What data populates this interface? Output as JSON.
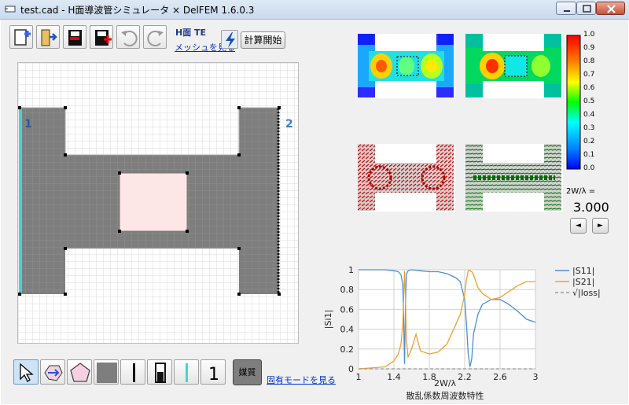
{
  "window": {
    "title": "test.cad - H面導波管シミュレータ  × DelFEM 1.6.0.3"
  },
  "toolbar": {
    "mode_label": "H面 TE",
    "mesh_link": "メッシュを見る",
    "calc_button": "計算開始"
  },
  "ports": {
    "port1": "1",
    "port2": "2"
  },
  "colorbar": {
    "ticks": [
      "1.0",
      "0.9",
      "0.8",
      "0.7",
      "0.6",
      "0.5",
      "0.4",
      "0.3",
      "0.2",
      "0.1",
      "0.0"
    ]
  },
  "frequency": {
    "label": "2W/λ =",
    "value": "3.000",
    "prev": "◄",
    "next": "►"
  },
  "bottom_toolbar": {
    "medium_label": "媒質",
    "eigen_link": "固有モードを見る"
  },
  "chart_data": {
    "type": "line",
    "xlabel": "2W/λ",
    "ylabel": "|Si1|",
    "title": "散乱係数周波数特性",
    "xlim": [
      1,
      3
    ],
    "ylim": [
      0,
      1
    ],
    "x_ticks": [
      "1",
      "1.4",
      "1.8",
      "2.2",
      "2.6",
      "3"
    ],
    "y_ticks": [
      "0",
      "0.2",
      "0.4",
      "0.6",
      "0.8",
      "1"
    ],
    "grid": true,
    "legend_position": "right",
    "series": [
      {
        "name": "|S11|",
        "color": "#4a90d9",
        "x": [
          1.0,
          1.3,
          1.4,
          1.45,
          1.48,
          1.5,
          1.51,
          1.52,
          1.53,
          1.54,
          1.56,
          1.6,
          1.7,
          1.8,
          1.9,
          2.0,
          2.1,
          2.15,
          2.2,
          2.22,
          2.24,
          2.26,
          2.28,
          2.3,
          2.35,
          2.4,
          2.5,
          2.6,
          2.7,
          2.8,
          2.9,
          3.0
        ],
        "y": [
          1.0,
          1.0,
          0.99,
          0.98,
          0.95,
          0.85,
          0.5,
          0.05,
          0.6,
          0.95,
          0.99,
          1.0,
          0.99,
          0.98,
          0.98,
          0.96,
          0.92,
          0.88,
          0.7,
          0.45,
          0.15,
          0.02,
          0.1,
          0.35,
          0.55,
          0.65,
          0.7,
          0.7,
          0.65,
          0.58,
          0.5,
          0.47
        ]
      },
      {
        "name": "|S21|",
        "color": "#f0a030",
        "x": [
          1.0,
          1.3,
          1.4,
          1.45,
          1.48,
          1.5,
          1.51,
          1.52,
          1.53,
          1.54,
          1.56,
          1.6,
          1.65,
          1.7,
          1.8,
          1.9,
          2.0,
          2.1,
          2.15,
          2.2,
          2.22,
          2.24,
          2.26,
          2.28,
          2.3,
          2.35,
          2.4,
          2.5,
          2.6,
          2.7,
          2.8,
          2.9,
          3.0
        ],
        "y": [
          0.0,
          0.02,
          0.08,
          0.15,
          0.25,
          0.45,
          0.7,
          0.99,
          0.75,
          0.3,
          0.12,
          0.2,
          0.35,
          0.18,
          0.15,
          0.17,
          0.25,
          0.45,
          0.55,
          0.75,
          0.9,
          0.99,
          0.99,
          0.98,
          0.95,
          0.82,
          0.76,
          0.7,
          0.72,
          0.78,
          0.84,
          0.88,
          0.88
        ]
      },
      {
        "name": "√|loss|",
        "color": "#999999",
        "dash": true,
        "x": [
          1.0,
          3.0
        ],
        "y": [
          0.0,
          0.0
        ]
      }
    ]
  }
}
